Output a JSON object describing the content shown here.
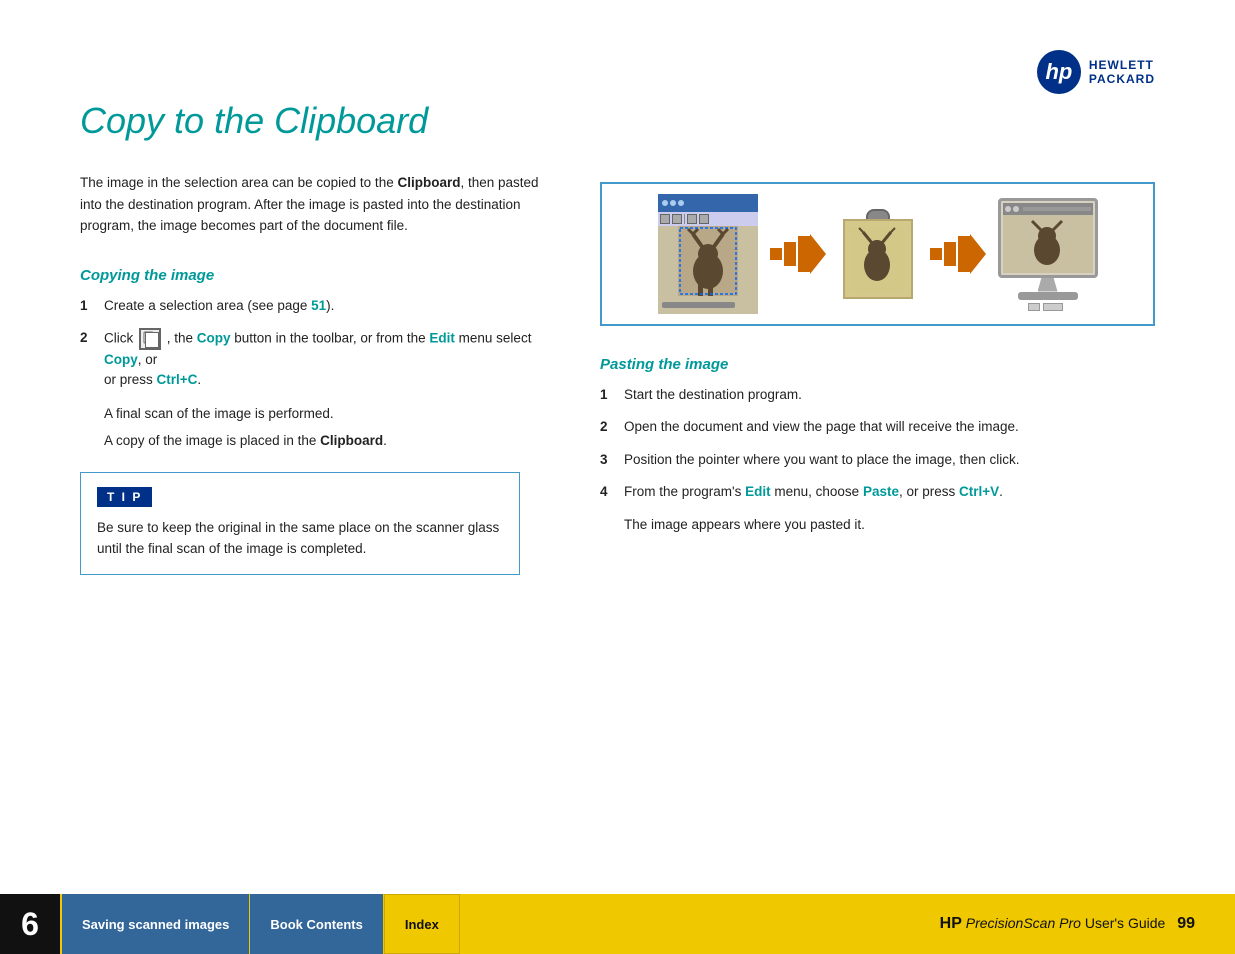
{
  "header": {
    "logo_text": "hp",
    "company_line1": "HEWLETT",
    "company_line2": "PACKARD"
  },
  "page": {
    "title": "Copy to the Clipboard",
    "intro": "The image in the selection area can be copied to the ",
    "intro_bold": "Clipboard",
    "intro_rest": ", then pasted into the destination program. After the image is pasted into the destination program, the image becomes part of the document file."
  },
  "copy_section": {
    "heading": "Copying the image",
    "steps": [
      {
        "num": "1",
        "text_pre": "Create a selection area (see page ",
        "link": "51",
        "text_post": ")."
      },
      {
        "num": "2",
        "text_pre": "Click ",
        "icon": "copy-icon",
        "text_mid": ", the ",
        "copy_link": "Copy",
        "text_mid2": " button in the toolbar, or from the ",
        "edit_link": "Edit",
        "text_mid3": " menu select ",
        "copy_link2": "Copy",
        "text_mid4": ", or or press ",
        "ctrl_link": "Ctrl+C",
        "text_post": "."
      }
    ],
    "after_steps": [
      "A final scan of the image is performed.",
      "A copy of the image is placed in the Clipboard."
    ]
  },
  "tip": {
    "label": "T I P",
    "text": "Be sure to keep the original in the same place on the scanner glass until the final scan of the image is completed."
  },
  "paste_section": {
    "heading": "Pasting the image",
    "steps": [
      {
        "num": "1",
        "text": "Start the destination program."
      },
      {
        "num": "2",
        "text": "Open the document and view the page that will receive the image."
      },
      {
        "num": "3",
        "text": "Position the pointer where you want to place the image, then click."
      },
      {
        "num": "4",
        "text_pre": "From the program's ",
        "edit_link": "Edit",
        "text_mid": " menu, choose ",
        "paste_link": "Paste",
        "text_mid2": ", or press ",
        "ctrl_link": "Ctrl+V",
        "text_post": "."
      }
    ],
    "after_steps": [
      "The image appears where you pasted it."
    ]
  },
  "footer": {
    "chapter_num": "6",
    "nav_buttons": [
      {
        "label": "Saving scanned images"
      },
      {
        "label": "Book Contents"
      },
      {
        "label": "Index"
      }
    ],
    "brand": "HP",
    "product_italic": "PrecisionScan Pro",
    "product_rest": " User's Guide",
    "page_num": "99"
  }
}
